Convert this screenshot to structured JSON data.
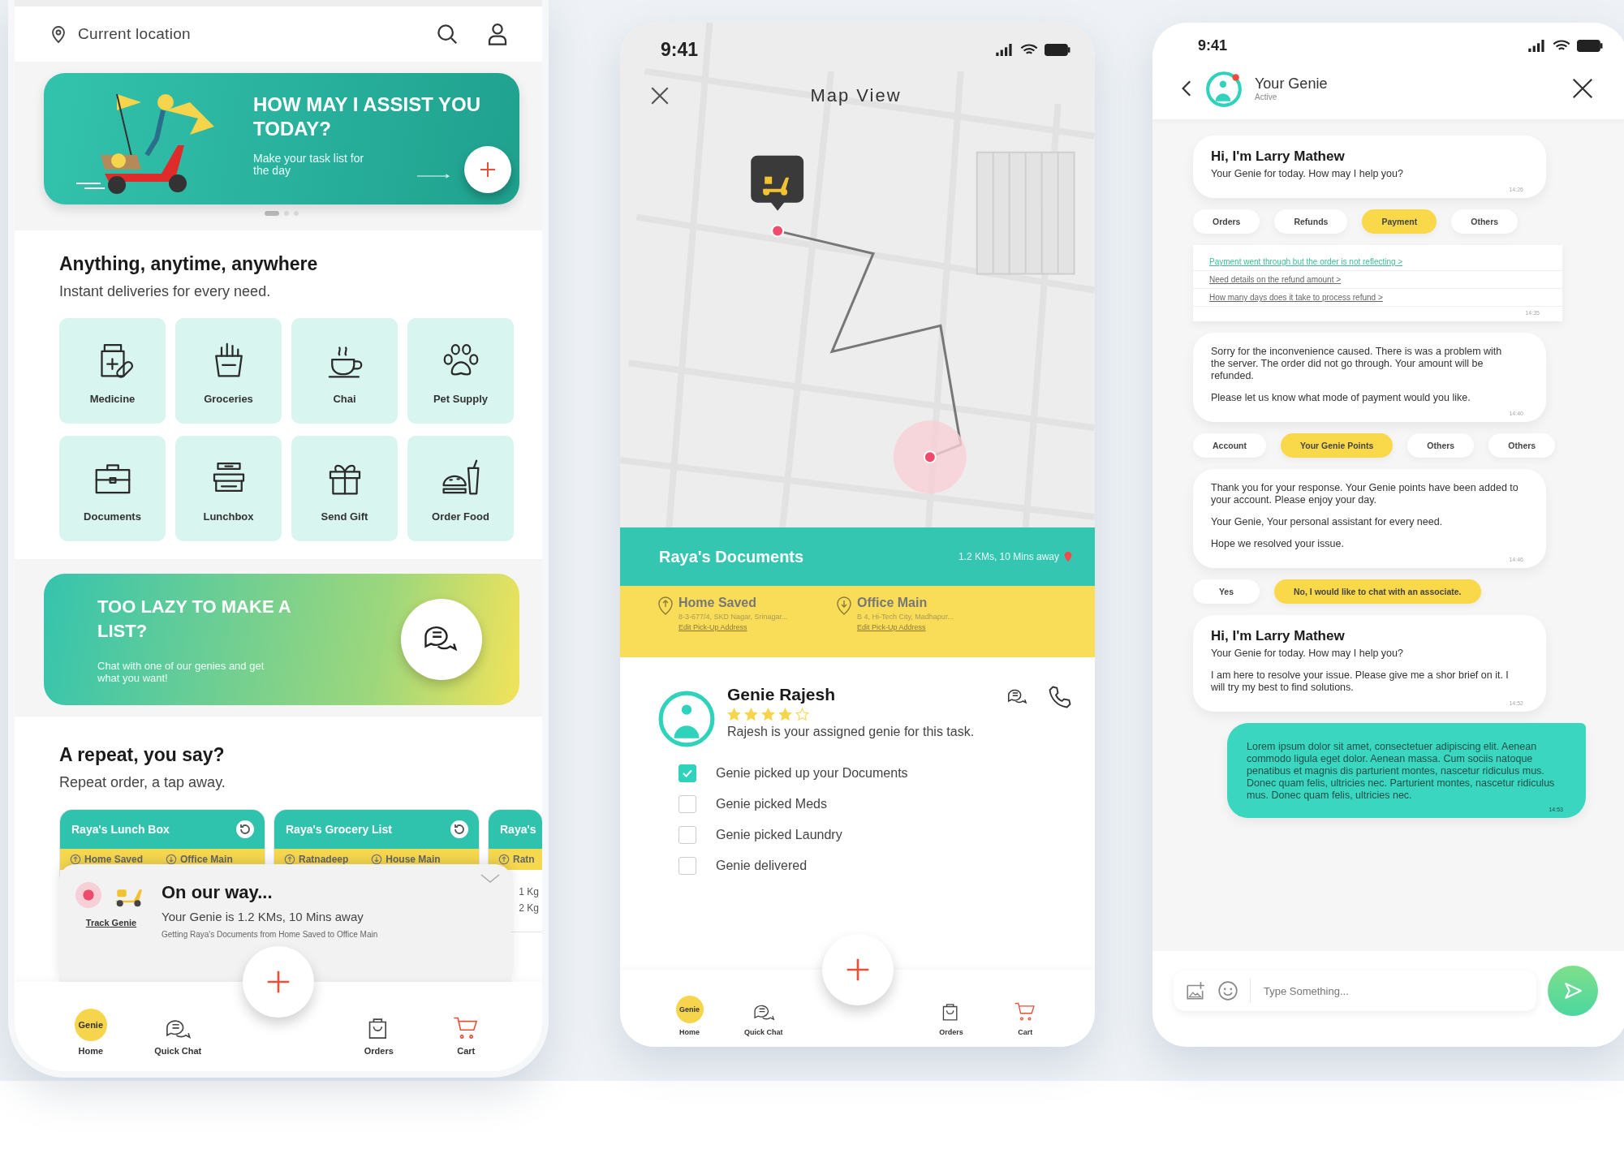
{
  "home": {
    "location": "Current location",
    "banner": {
      "title": "HOW MAY I ASSIST YOU TODAY?",
      "subtitle": "Make your task list for the day"
    },
    "carousel_dots": [
      {
        "selected": true
      },
      {
        "selected": false
      },
      {
        "selected": false
      }
    ],
    "section_title": "Anything, anytime, anywhere",
    "section_subtitle": "Instant deliveries for every need.",
    "categories": [
      {
        "label": "Medicine",
        "kind": "medicine"
      },
      {
        "label": "Groceries",
        "kind": "groceries"
      },
      {
        "label": "Chai",
        "kind": "chai"
      },
      {
        "label": "Pet Supply",
        "kind": "pet"
      },
      {
        "label": "Documents",
        "kind": "documents"
      },
      {
        "label": "Lunchbox",
        "kind": "lunchbox"
      },
      {
        "label": "Send Gift",
        "kind": "gift"
      },
      {
        "label": "Order Food",
        "kind": "food"
      }
    ],
    "promo": {
      "title": "TOO LAZY TO MAKE A LIST?",
      "subtitle": "Chat with one of our genies and get what you want!"
    },
    "repeat_title": "A repeat, you say?",
    "repeat_subtitle": "Repeat order, a tap away.",
    "repeat_cards": [
      {
        "title": "Raya's Lunch Box",
        "from": "Home Saved",
        "to": "Office Main"
      },
      {
        "title": "Raya's Grocery List",
        "from": "Ratnadeep",
        "to": "House Main"
      },
      {
        "title": "Raya's",
        "from": "Ratn",
        "items": [
          "1 Kg",
          "2 Kg"
        ]
      }
    ],
    "tracking": {
      "title": "On our way...",
      "distance": "Your Genie is 1.2 KMs, 10 Mins away",
      "details": "Getting Raya's Documents from Home Saved to Office Main",
      "link": "Track Genie"
    },
    "nav": [
      {
        "kind": "home",
        "label": "Home",
        "logo": "Genie"
      },
      {
        "kind": "chat",
        "label": "Quick Chat"
      },
      {
        "kind": "orders",
        "label": "Orders"
      },
      {
        "kind": "cart",
        "label": "Cart"
      }
    ]
  },
  "map": {
    "time": "9:41",
    "title": "Map View",
    "order": {
      "title": "Raya's Documents",
      "eta": "1.2 KMs, 10 Mins away",
      "pickup": {
        "name": "Home Saved",
        "address": "8-3-677/4, SKD Nagar, Srinagar...",
        "action": "Edit Pick-Up Address"
      },
      "drop": {
        "name": "Office Main",
        "address": "B 4, Hi-Tech City, Madhapur...",
        "action": "Edit Pick-Up Address"
      }
    },
    "genie": {
      "name": "Genie Rajesh",
      "stars": 4,
      "note": "Rajesh is your assigned genie for this task."
    },
    "steps": [
      {
        "label": "Genie picked up your Documents",
        "checked": true
      },
      {
        "label": "Genie picked Meds",
        "checked": false
      },
      {
        "label": "Genie picked Laundry",
        "checked": false
      },
      {
        "label": "Genie delivered",
        "checked": false
      }
    ],
    "nav": [
      {
        "kind": "home",
        "label": "Home",
        "logo": "Genie"
      },
      {
        "kind": "chat",
        "label": "Quick Chat"
      },
      {
        "kind": "orders",
        "label": "Orders"
      },
      {
        "kind": "cart",
        "label": "Cart"
      }
    ]
  },
  "chat": {
    "time": "9:41",
    "contact": "Your Genie",
    "status": "Active",
    "thread": [
      {
        "kind": "bot",
        "title": "Hi, I'm Larry Mathew",
        "paragraphs": [
          "Your Genie for today. How may I help you?"
        ],
        "time": "14:26"
      },
      {
        "kind": "chips",
        "chips": [
          {
            "label": "Orders",
            "selected": false
          },
          {
            "label": "Refunds",
            "selected": false
          },
          {
            "label": "Payment",
            "selected": true
          },
          {
            "label": "Others",
            "selected": false
          }
        ]
      },
      {
        "kind": "links",
        "links": [
          {
            "label": "Payment went through but the order is not reflecting >",
            "selected": true
          },
          {
            "label": "Need details on the refund amount >",
            "selected": false
          },
          {
            "label": "How many days does it take to process refund >",
            "selected": false
          }
        ],
        "time": "14:35"
      },
      {
        "kind": "bot",
        "paragraphs": [
          "Sorry for the inconvenience caused. There is was a problem with the server. The order did not go through. Your amount will be refunded.",
          "Please let us know what mode of payment would you like."
        ],
        "time": "14:40"
      },
      {
        "kind": "chips",
        "chips": [
          {
            "label": "Account",
            "selected": false
          },
          {
            "label": "Your Genie Points",
            "selected": true
          },
          {
            "label": "Others",
            "selected": false
          },
          {
            "label": "Others",
            "selected": false
          }
        ]
      },
      {
        "kind": "bot",
        "paragraphs": [
          "Thank you for your response. Your Genie points have been added to your account. Please enjoy your day.",
          "Your Genie, Your personal assistant for every need.",
          "Hope we resolved your issue."
        ],
        "time": "14:46"
      },
      {
        "kind": "chips",
        "chips": [
          {
            "label": "Yes",
            "selected": false
          },
          {
            "label": "No, I would like to chat with an associate.",
            "selected": true
          }
        ]
      },
      {
        "kind": "bot",
        "title": "Hi, I'm Larry Mathew",
        "paragraphs": [
          "Your Genie for today. How may I help you?",
          "I am here to resolve your issue. Please give me a shor brief on it. I will try my best to find solutions."
        ],
        "time": "14:52"
      },
      {
        "kind": "user",
        "paragraphs": [
          "Lorem ipsum dolor sit amet, consectetuer adipiscing elit. Aenean commodo ligula eget dolor. Aenean massa. Cum sociis natoque penatibus et magnis dis parturient montes, nascetur ridiculus mus. Donec quam felis, ultricies nec. Parturient montes, nascetur ridiculus mus. Donec quam felis, ultricies nec."
        ],
        "time": "14:53"
      }
    ],
    "placeholder": "Type Something..."
  }
}
